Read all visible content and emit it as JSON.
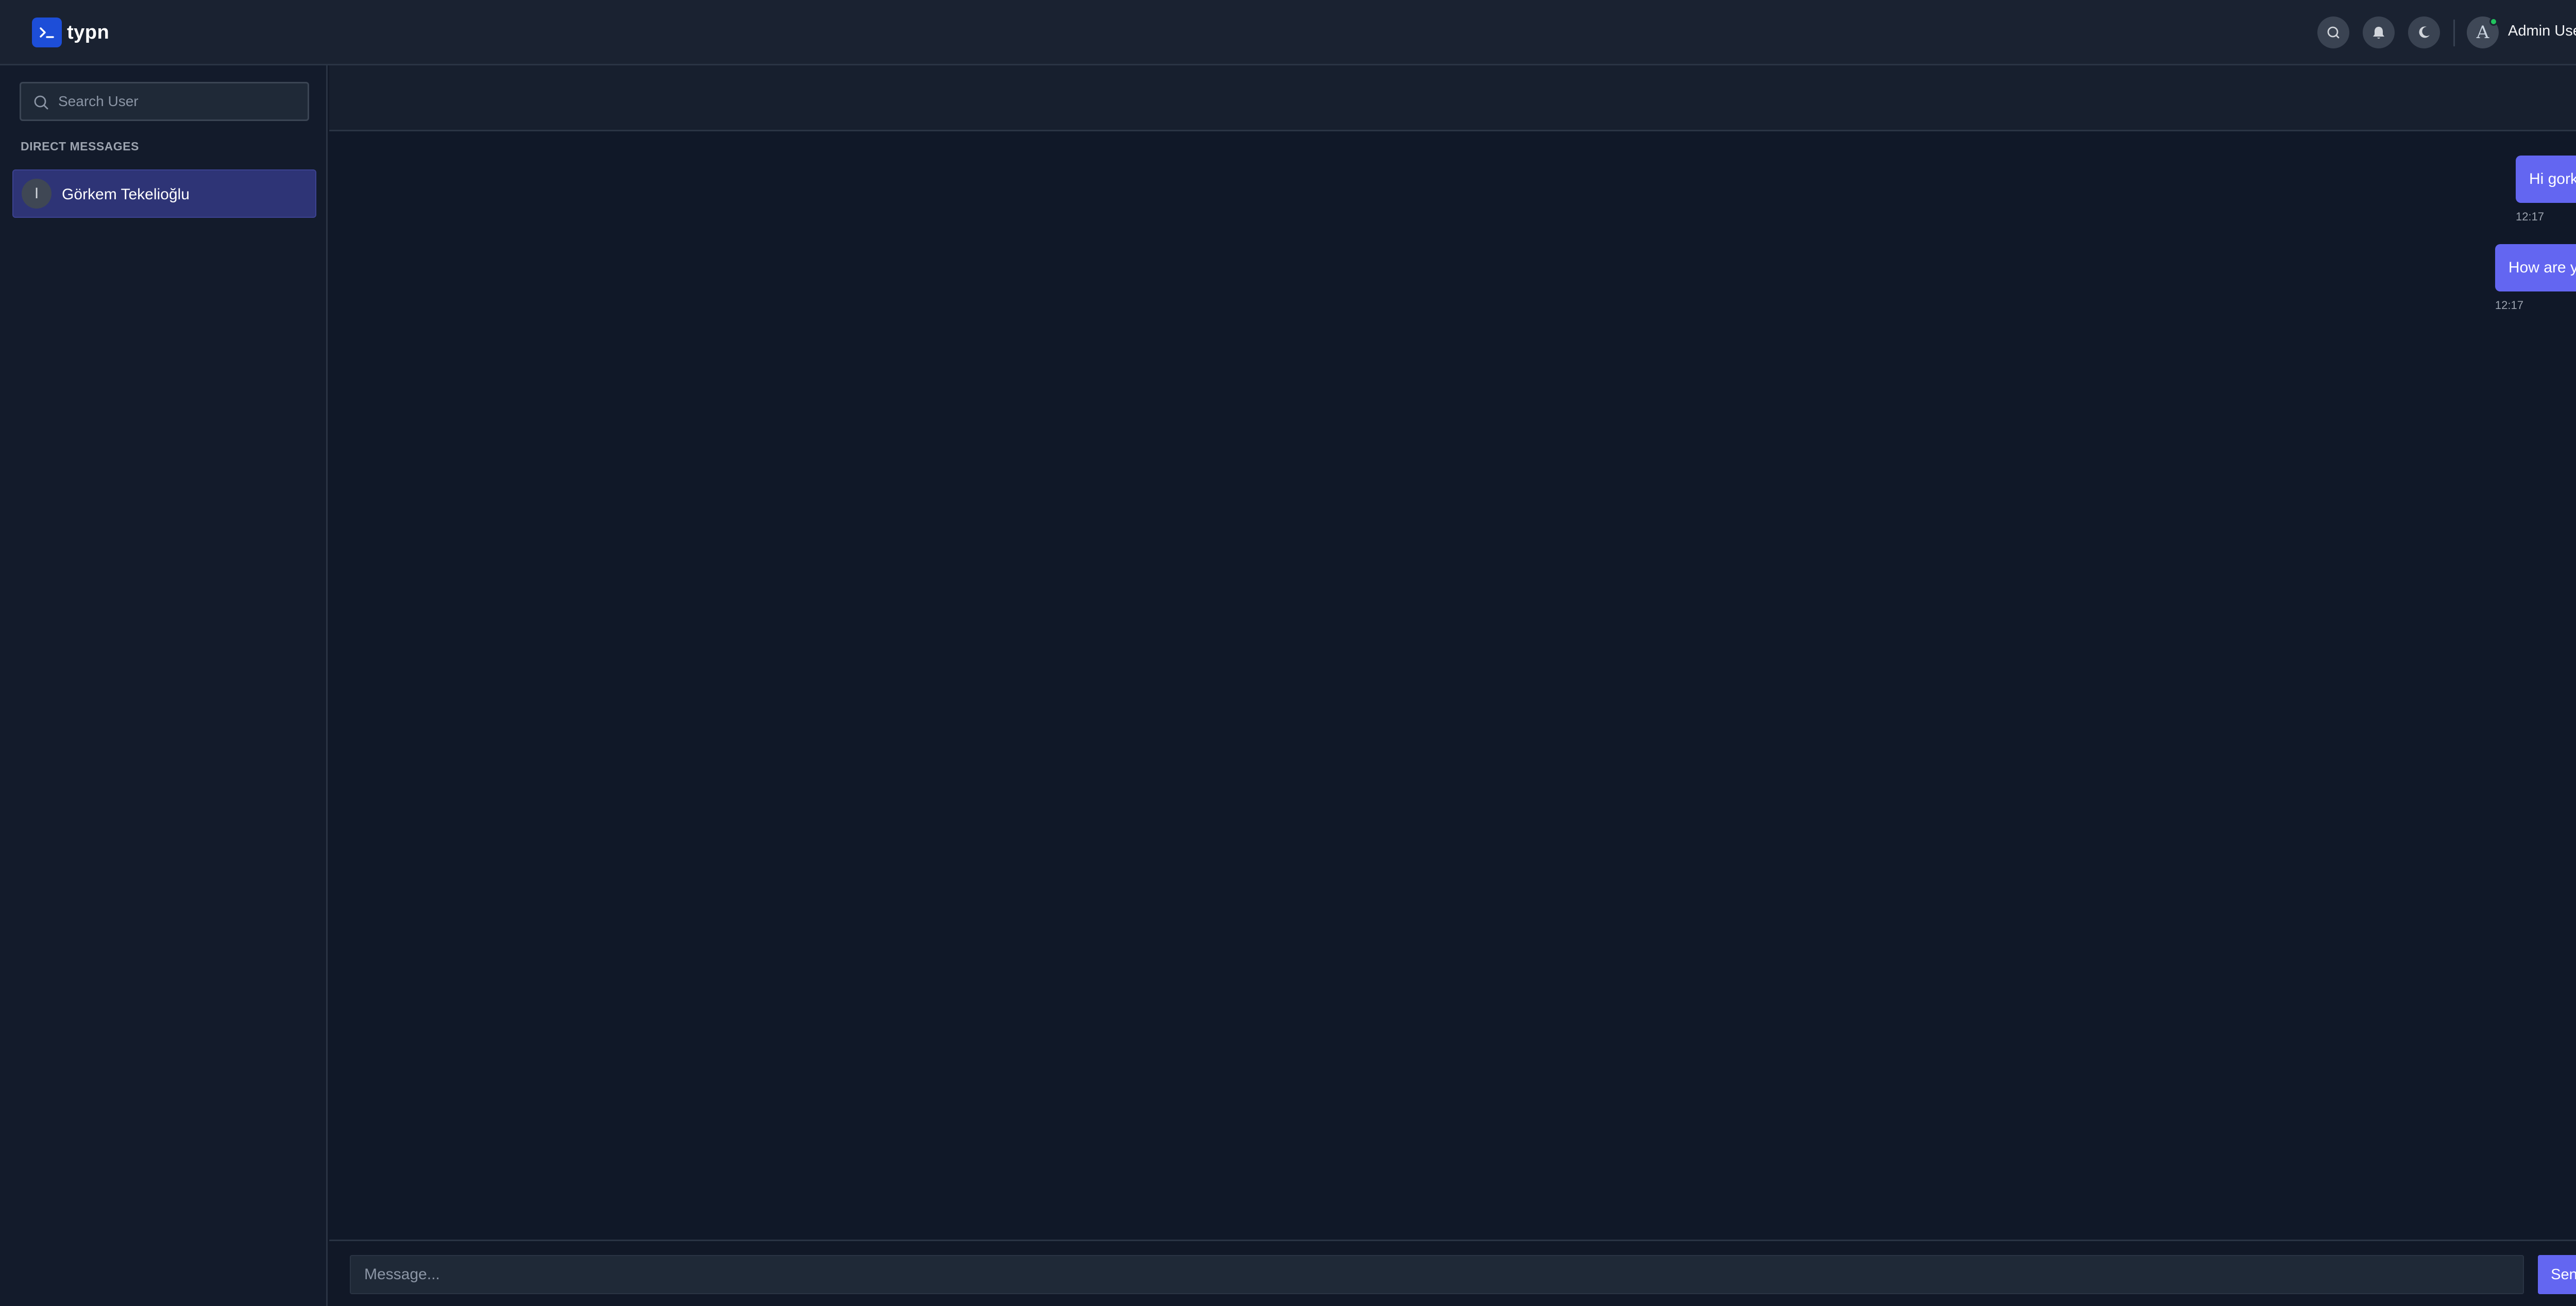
{
  "app": {
    "name": "typn",
    "logo_glyph": "›_",
    "brand_color": "#1d4ed8",
    "accent_color": "#6366f1"
  },
  "header": {
    "icons": [
      "search-icon",
      "bell-icon",
      "moon-icon"
    ],
    "user": {
      "avatar_initial": "A",
      "name": "Admin User",
      "status": "online"
    }
  },
  "sidebar": {
    "search_placeholder": "Search User",
    "section_title": "DIRECT MESSAGES",
    "contacts": [
      {
        "name": "Görkem Tekelioğlu",
        "avatar_initial": "I",
        "active": true
      }
    ]
  },
  "chat": {
    "info_icon": "info-icon",
    "messages": [
      {
        "text": "Hi gorkem!",
        "time": "12:17",
        "outgoing": true
      },
      {
        "text": "How are you?",
        "time": "12:17",
        "outgoing": true
      }
    ],
    "composer": {
      "placeholder": "Message...",
      "send_label": "Send",
      "send_icon": "→"
    }
  }
}
